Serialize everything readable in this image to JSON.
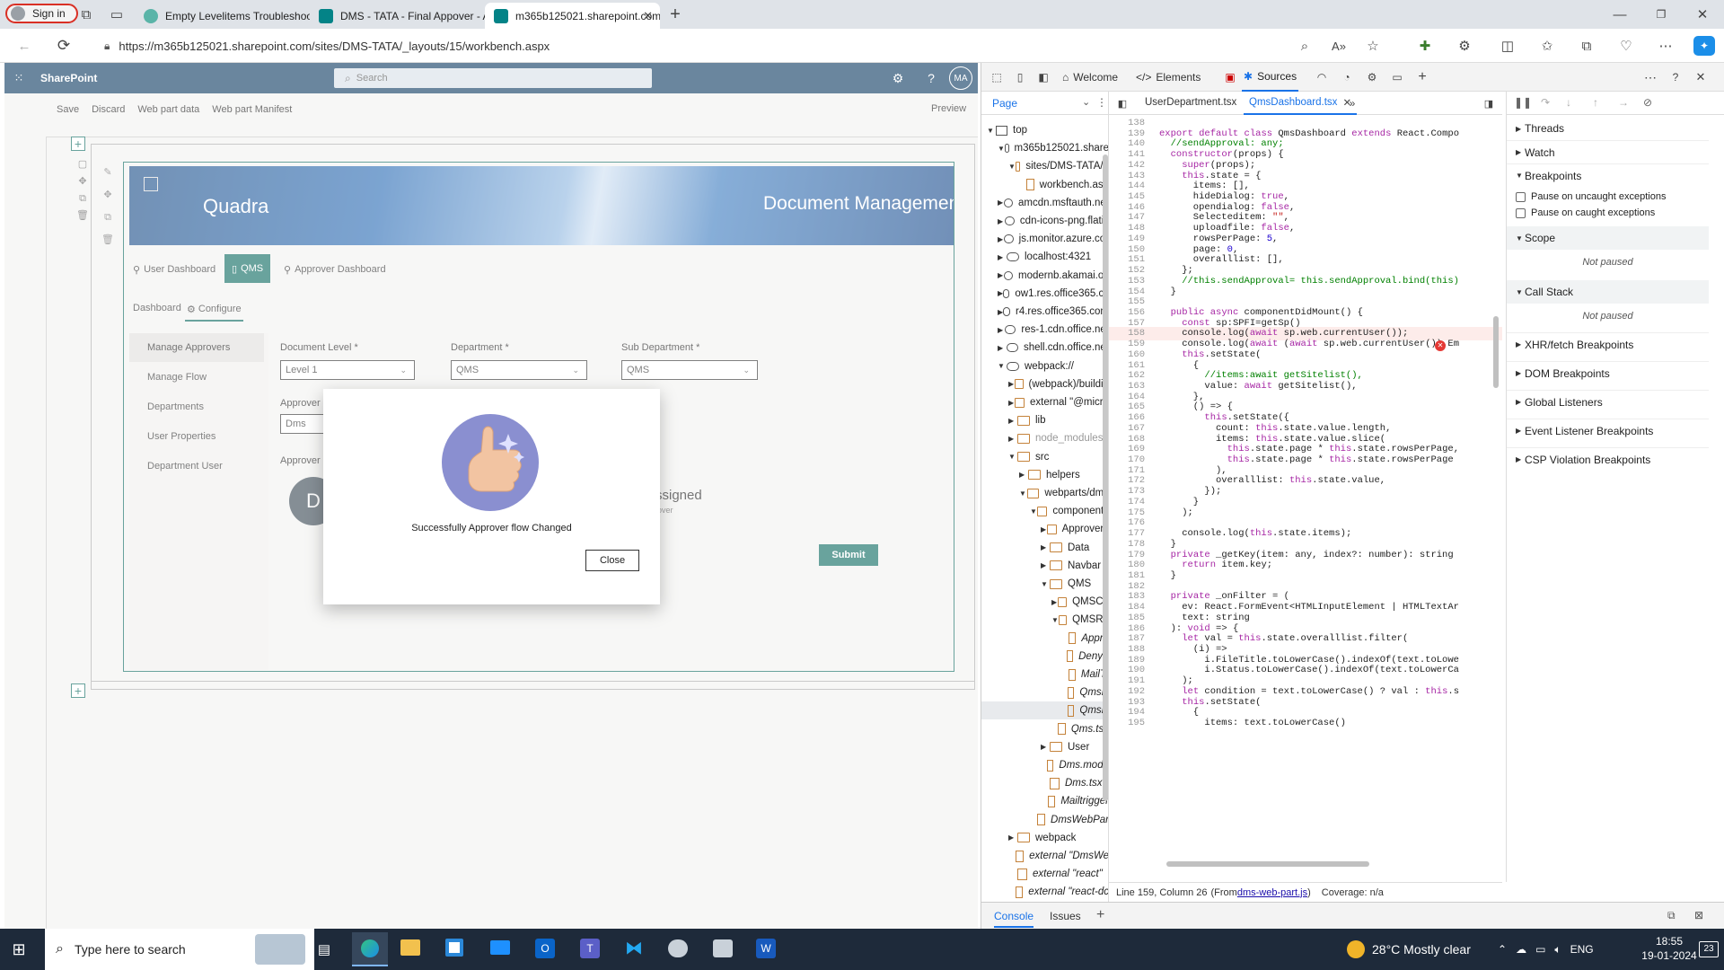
{
  "browser": {
    "sign_in_label": "Sign in",
    "tabs": [
      {
        "title": "Empty Levelitems Troubleshootin"
      },
      {
        "title": "DMS - TATA - Final Appover - All"
      },
      {
        "title": "m365b125021.sharepoint.com/si"
      }
    ],
    "url": "https://m365b125021.sharepoint.com/sites/DMS-TATA/_layouts/15/workbench.aspx"
  },
  "sharepoint": {
    "brand": "SharePoint",
    "search_placeholder": "Search",
    "avatar_initials": "MA",
    "commands": [
      "Save",
      "Discard",
      "Web part data",
      "Web part Manifest"
    ],
    "preview_label": "Preview",
    "banner_left": "Quadra",
    "banner_right": "Document Management",
    "top_nav": [
      {
        "label": "User Dashboard"
      },
      {
        "label": "QMS"
      },
      {
        "label": "Approver Dashboard"
      }
    ],
    "sub_tabs": [
      "Dashboard",
      "Configure"
    ],
    "left_nav": [
      "Manage Approvers",
      "Manage Flow",
      "Departments",
      "User Properties",
      "Department User"
    ],
    "fields": [
      {
        "label": "Document Level *",
        "value": "Level 1"
      },
      {
        "label": "Department *",
        "value": "QMS"
      },
      {
        "label": "Sub Department *",
        "value": "QMS"
      }
    ],
    "approver_label_partial": "Approver Z",
    "approver_value": "Dms",
    "approver_label2_partial": "Approver I",
    "persona_initial": "D",
    "persona_text_partial": "ssigned",
    "persona_sub_partial": "over",
    "submit_label": "Submit",
    "dialog": {
      "message": "Successfully Approver flow Changed",
      "close_label": "Close"
    }
  },
  "devtools": {
    "tabs": [
      "Welcome",
      "Elements",
      "Sources"
    ],
    "nav_tab": "Page",
    "file_tabs": [
      "UserDepartment.tsx",
      "QmsDashboard.tsx"
    ],
    "tree": [
      {
        "label": "top",
        "depth": 0,
        "kind": "frame",
        "open": true
      },
      {
        "label": "m365b125021.share",
        "depth": 1,
        "kind": "cloud",
        "open": true
      },
      {
        "label": "sites/DMS-TATA/_",
        "depth": 2,
        "kind": "folder",
        "open": true
      },
      {
        "label": "workbench.asp",
        "depth": 3,
        "kind": "file"
      },
      {
        "label": "amcdn.msftauth.net",
        "depth": 1,
        "kind": "cloud",
        "open": false
      },
      {
        "label": "cdn-icons-png.flatic",
        "depth": 1,
        "kind": "cloud",
        "open": false
      },
      {
        "label": "js.monitor.azure.cor",
        "depth": 1,
        "kind": "cloud",
        "open": false
      },
      {
        "label": "localhost:4321",
        "depth": 1,
        "kind": "cloud",
        "open": false
      },
      {
        "label": "modernb.akamai.oc",
        "depth": 1,
        "kind": "cloud",
        "open": false
      },
      {
        "label": "ow1.res.office365.cc",
        "depth": 1,
        "kind": "cloud",
        "open": false
      },
      {
        "label": "r4.res.office365.com",
        "depth": 1,
        "kind": "cloud",
        "open": false
      },
      {
        "label": "res-1.cdn.office.net",
        "depth": 1,
        "kind": "cloud",
        "open": false
      },
      {
        "label": "shell.cdn.office.net",
        "depth": 1,
        "kind": "cloud",
        "open": false
      },
      {
        "label": "webpack://",
        "depth": 1,
        "kind": "cloud",
        "open": true
      },
      {
        "label": "(webpack)/buildin",
        "depth": 2,
        "kind": "folder",
        "open": false
      },
      {
        "label": "external \"@micro",
        "depth": 2,
        "kind": "folder",
        "open": false
      },
      {
        "label": "lib",
        "depth": 2,
        "kind": "folder",
        "open": false
      },
      {
        "label": "node_modules",
        "depth": 2,
        "kind": "folder",
        "open": false,
        "dim": true
      },
      {
        "label": "src",
        "depth": 2,
        "kind": "folder",
        "open": true
      },
      {
        "label": "helpers",
        "depth": 3,
        "kind": "folder",
        "open": false
      },
      {
        "label": "webparts/dms",
        "depth": 3,
        "kind": "folder",
        "open": true
      },
      {
        "label": "components",
        "depth": 4,
        "kind": "folder",
        "open": true
      },
      {
        "label": "Approvers",
        "depth": 5,
        "kind": "folder",
        "open": false
      },
      {
        "label": "Data",
        "depth": 5,
        "kind": "folder",
        "open": false
      },
      {
        "label": "Navbar",
        "depth": 5,
        "kind": "folder",
        "open": false
      },
      {
        "label": "QMS",
        "depth": 5,
        "kind": "folder",
        "open": true
      },
      {
        "label": "QMSCo",
        "depth": 6,
        "kind": "folder",
        "open": false
      },
      {
        "label": "QMSRe",
        "depth": 6,
        "kind": "folder",
        "open": true
      },
      {
        "label": "Appro",
        "depth": 7,
        "kind": "file",
        "italic": true
      },
      {
        "label": "DenyF",
        "depth": 7,
        "kind": "file",
        "italic": true
      },
      {
        "label": "MailTr",
        "depth": 7,
        "kind": "file",
        "italic": true
      },
      {
        "label": "QmsD",
        "depth": 7,
        "kind": "file",
        "italic": true
      },
      {
        "label": "QmsD",
        "depth": 7,
        "kind": "file",
        "italic": true,
        "selected": true
      },
      {
        "label": "Qms.tsx",
        "depth": 6,
        "kind": "file",
        "italic": true
      },
      {
        "label": "User",
        "depth": 5,
        "kind": "folder",
        "open": false
      },
      {
        "label": "Dms.modu",
        "depth": 5,
        "kind": "file",
        "italic": true
      },
      {
        "label": "Dms.tsx",
        "depth": 5,
        "kind": "file",
        "italic": true
      },
      {
        "label": "Mailtrigger",
        "depth": 5,
        "kind": "file",
        "italic": true
      },
      {
        "label": "DmsWebPar",
        "depth": 4,
        "kind": "file",
        "italic": true
      },
      {
        "label": "webpack",
        "depth": 2,
        "kind": "folder",
        "open": false
      },
      {
        "label": "external \"DmsWe",
        "depth": 2,
        "kind": "file",
        "italic": true
      },
      {
        "label": "external \"react\"",
        "depth": 2,
        "kind": "file",
        "italic": true
      },
      {
        "label": "external \"react-dc",
        "depth": 2,
        "kind": "file",
        "italic": true
      }
    ],
    "code": [
      {
        "n": "138",
        "t": ""
      },
      {
        "n": "139",
        "t": "export default class QmsDashboard extends React.Compo"
      },
      {
        "n": "140",
        "t": "  //sendApproval: any;"
      },
      {
        "n": "141",
        "t": "  constructor(props) {"
      },
      {
        "n": "142",
        "t": "    super(props);"
      },
      {
        "n": "143",
        "t": "    this.state = {"
      },
      {
        "n": "144",
        "t": "      items: [],"
      },
      {
        "n": "145",
        "t": "      hideDialog: true,"
      },
      {
        "n": "146",
        "t": "      opendialog: false,"
      },
      {
        "n": "147",
        "t": "      Selecteditem: \"\","
      },
      {
        "n": "148",
        "t": "      uploadfile: false,"
      },
      {
        "n": "149",
        "t": "      rowsPerPage: 5,"
      },
      {
        "n": "150",
        "t": "      page: 0,"
      },
      {
        "n": "151",
        "t": "      overalllist: [],"
      },
      {
        "n": "152",
        "t": "    };"
      },
      {
        "n": "153",
        "t": "    //this.sendApproval= this.sendApproval.bind(this)"
      },
      {
        "n": "154",
        "t": "  }"
      },
      {
        "n": "155",
        "t": ""
      },
      {
        "n": "156",
        "t": "  public async componentDidMount() {"
      },
      {
        "n": "157",
        "t": "    const sp:SPFI=getSp()"
      },
      {
        "n": "158",
        "t": "    console.log(await sp.web.currentUser());"
      },
      {
        "n": "159",
        "t": "    console.log(await (await sp.web.currentUser()).Em"
      },
      {
        "n": "160",
        "t": "    this.setState("
      },
      {
        "n": "161",
        "t": "      {"
      },
      {
        "n": "162",
        "t": "        //items:await getSitelist(),"
      },
      {
        "n": "163",
        "t": "        value: await getSitelist(),"
      },
      {
        "n": "164",
        "t": "      },"
      },
      {
        "n": "165",
        "t": "      () => {"
      },
      {
        "n": "166",
        "t": "        this.setState({"
      },
      {
        "n": "167",
        "t": "          count: this.state.value.length,"
      },
      {
        "n": "168",
        "t": "          items: this.state.value.slice("
      },
      {
        "n": "169",
        "t": "            this.state.page * this.state.rowsPerPage,"
      },
      {
        "n": "170",
        "t": "            this.state.page * this.state.rowsPerPage"
      },
      {
        "n": "171",
        "t": "          ),"
      },
      {
        "n": "172",
        "t": "          overalllist: this.state.value,"
      },
      {
        "n": "173",
        "t": "        });"
      },
      {
        "n": "174",
        "t": "      }"
      },
      {
        "n": "175",
        "t": "    );"
      },
      {
        "n": "176",
        "t": ""
      },
      {
        "n": "177",
        "t": "    console.log(this.state.items);"
      },
      {
        "n": "178",
        "t": "  }"
      },
      {
        "n": "179",
        "t": "  private _getKey(item: any, index?: number): string"
      },
      {
        "n": "180",
        "t": "    return item.key;"
      },
      {
        "n": "181",
        "t": "  }"
      },
      {
        "n": "182",
        "t": ""
      },
      {
        "n": "183",
        "t": "  private _onFilter = ("
      },
      {
        "n": "184",
        "t": "    ev: React.FormEvent<HTMLInputElement | HTMLTextAr"
      },
      {
        "n": "185",
        "t": "    text: string"
      },
      {
        "n": "186",
        "t": "  ): void => {"
      },
      {
        "n": "187",
        "t": "    let val = this.state.overalllist.filter("
      },
      {
        "n": "188",
        "t": "      (i) =>"
      },
      {
        "n": "189",
        "t": "        i.FileTitle.toLowerCase().indexOf(text.toLowe"
      },
      {
        "n": "190",
        "t": "        i.Status.toLowerCase().indexOf(text.toLowerCa"
      },
      {
        "n": "191",
        "t": "    );"
      },
      {
        "n": "192",
        "t": "    let condition = text.toLowerCase() ? val : this.s"
      },
      {
        "n": "193",
        "t": "    this.setState("
      },
      {
        "n": "194",
        "t": "      {"
      },
      {
        "n": "195",
        "t": "        items: text.toLowerCase()"
      }
    ],
    "status_position": "Line 159, Column 26",
    "status_from_prefix": "(From ",
    "status_from_link": "dms-web-part.js",
    "status_from_suffix": ")",
    "status_coverage": "Coverage: n/a",
    "debug_sections": [
      {
        "label": "Threads",
        "open": false
      },
      {
        "label": "Watch",
        "open": false
      },
      {
        "label": "Breakpoints",
        "open": true
      }
    ],
    "breakpoint_options": [
      "Pause on uncaught exceptions",
      "Pause on caught exceptions"
    ],
    "scope_label": "Scope",
    "scope_status": "Not paused",
    "callstack_label": "Call Stack",
    "callstack_status": "Not paused",
    "more_sections": [
      "XHR/fetch Breakpoints",
      "DOM Breakpoints",
      "Global Listeners",
      "Event Listener Breakpoints",
      "CSP Violation Breakpoints"
    ],
    "drawer_tabs": [
      "Console",
      "Issues"
    ]
  },
  "taskbar": {
    "search_placeholder": "Type here to search",
    "weather": "28°C  Mostly clear",
    "language": "ENG",
    "time": "18:55",
    "date": "19-01-2024",
    "notifications": "23"
  },
  "colors": {
    "sp_suite_bar": "#0f3c63",
    "accent_teal": "#0e6b62",
    "devtools_blue": "#1a73e8",
    "error_red": "#e53935",
    "code_keyword": "#a626a4",
    "code_string": "#c41a16",
    "code_comment": "#008000"
  }
}
